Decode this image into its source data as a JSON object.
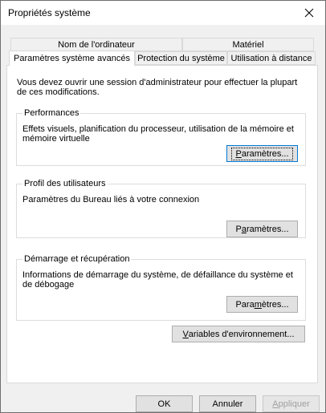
{
  "window": {
    "title": "Propriétés système",
    "close_glyph": "✕"
  },
  "tabs": {
    "row1": [
      {
        "label": "Nom de l'ordinateur"
      },
      {
        "label": "Matériel"
      }
    ],
    "row2": [
      {
        "label": "Paramètres système avancés",
        "selected": true
      },
      {
        "label": "Protection du système"
      },
      {
        "label": "Utilisation à distance"
      }
    ]
  },
  "panel": {
    "intro": "Vous devez ouvrir une session d'administrateur pour effectuer la plupart de ces modifications.",
    "performance": {
      "title": "Performances",
      "description": "Effets visuels, planification du processeur, utilisation de la mémoire et mémoire virtuelle",
      "button": {
        "pre": "",
        "mnemonic": "P",
        "post": "aramètres..."
      }
    },
    "profiles": {
      "title": "Profil des utilisateurs",
      "description": "Paramètres du Bureau liés à votre connexion",
      "button": {
        "pre": "P",
        "mnemonic": "a",
        "post": "ramètres..."
      }
    },
    "startup": {
      "title": "Démarrage et récupération",
      "description": "Informations de démarrage du système, de défaillance du système et de débogage",
      "button": {
        "pre": "Para",
        "mnemonic": "m",
        "post": "ètres..."
      }
    },
    "env_button": {
      "pre": "",
      "mnemonic": "V",
      "post": "ariables d'environnement..."
    }
  },
  "footer": {
    "ok": "OK",
    "cancel": "Annuler",
    "apply": {
      "pre": "",
      "mnemonic": "A",
      "post": "ppliquer"
    }
  }
}
